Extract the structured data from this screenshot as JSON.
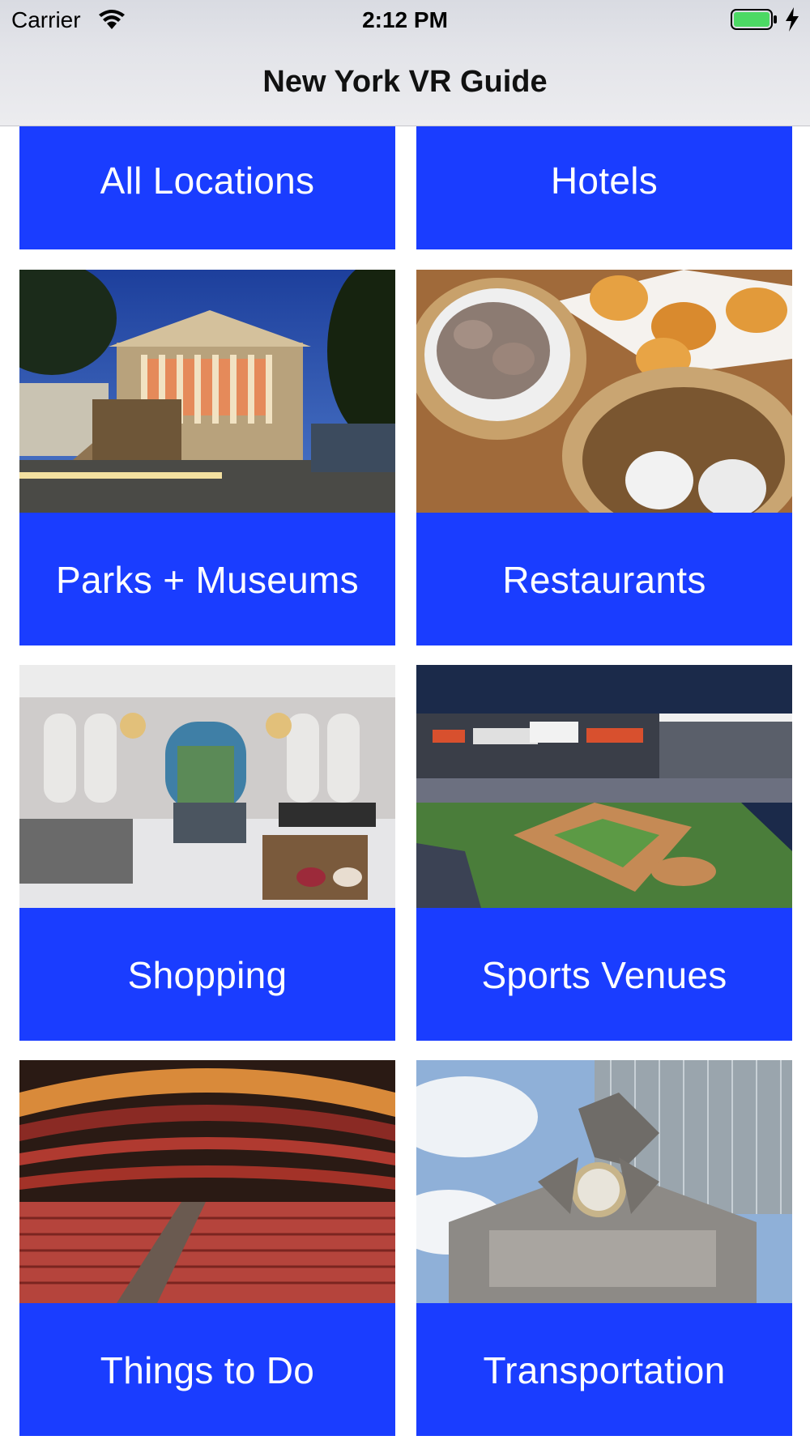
{
  "status_bar": {
    "carrier": "Carrier",
    "time": "2:12 PM",
    "battery_color": "#4cd964"
  },
  "nav": {
    "title": "New York VR Guide"
  },
  "categories": [
    {
      "label": "All Locations",
      "has_image": false
    },
    {
      "label": "Hotels",
      "has_image": false
    },
    {
      "label": "Parks + Museums",
      "has_image": true,
      "image": "museum-photo"
    },
    {
      "label": "Restaurants",
      "has_image": true,
      "image": "dim-sum-photo"
    },
    {
      "label": "Shopping",
      "has_image": true,
      "image": "luxury-store-photo"
    },
    {
      "label": "Sports Venues",
      "has_image": true,
      "image": "baseball-stadium-photo"
    },
    {
      "label": "Things to Do",
      "has_image": true,
      "image": "theater-photo"
    },
    {
      "label": "Transportation",
      "has_image": true,
      "image": "grand-central-photo"
    }
  ],
  "colors": {
    "tile_blue": "#1a3dff",
    "nav_background": "#e3e4e9"
  }
}
